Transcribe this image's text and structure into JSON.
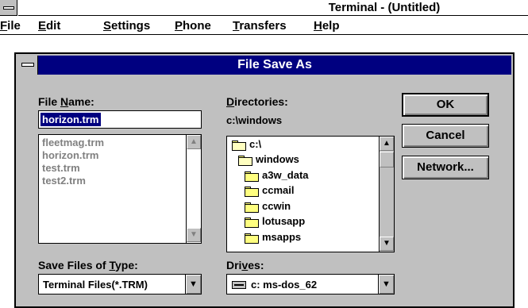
{
  "app": {
    "title": "Terminal - (Untitled)",
    "menu": [
      {
        "label": "File",
        "key": "F",
        "rest": "ile"
      },
      {
        "label": "Edit",
        "key": "E",
        "rest": "dit"
      },
      {
        "label": "Settings",
        "key": "S",
        "rest": "ettings"
      },
      {
        "label": "Phone",
        "key": "P",
        "rest": "hone"
      },
      {
        "label": "Transfers",
        "key": "T",
        "rest": "ransfers"
      },
      {
        "label": "Help",
        "key": "H",
        "rest": "elp"
      }
    ]
  },
  "dialog": {
    "title": "File Save As",
    "filename_label_pre": "File ",
    "filename_label_key": "N",
    "filename_label_post": "ame:",
    "filename_value": "horizon.trm",
    "files": [
      "fleetmag.trm",
      "horizon.trm",
      "test.trm",
      "test2.trm"
    ],
    "directories_label_key": "D",
    "directories_label_post": "irectories:",
    "current_dir": "c:\\windows",
    "dirs": [
      "c:\\",
      "windows",
      "a3w_data",
      "ccmail",
      "ccwin",
      "lotusapp",
      "msapps"
    ],
    "type_label_pre": "Save Files of ",
    "type_label_key": "T",
    "type_label_post": "ype:",
    "type_value": "Terminal Files(*.TRM)",
    "drives_label_pre": "Dri",
    "drives_label_key": "v",
    "drives_label_post": "es:",
    "drive_value": "c: ms-dos_62",
    "buttons": {
      "ok": "OK",
      "cancel": "Cancel",
      "network": "Network..."
    }
  },
  "colors": {
    "titlebar": "#000080",
    "face": "#c0c0c0",
    "selection": "#000080"
  },
  "icons": [
    "system-menu-icon",
    "folder-open-icon",
    "folder-icon",
    "drive-icon",
    "scroll-up-icon",
    "scroll-down-icon",
    "dropdown-arrow-icon"
  ]
}
